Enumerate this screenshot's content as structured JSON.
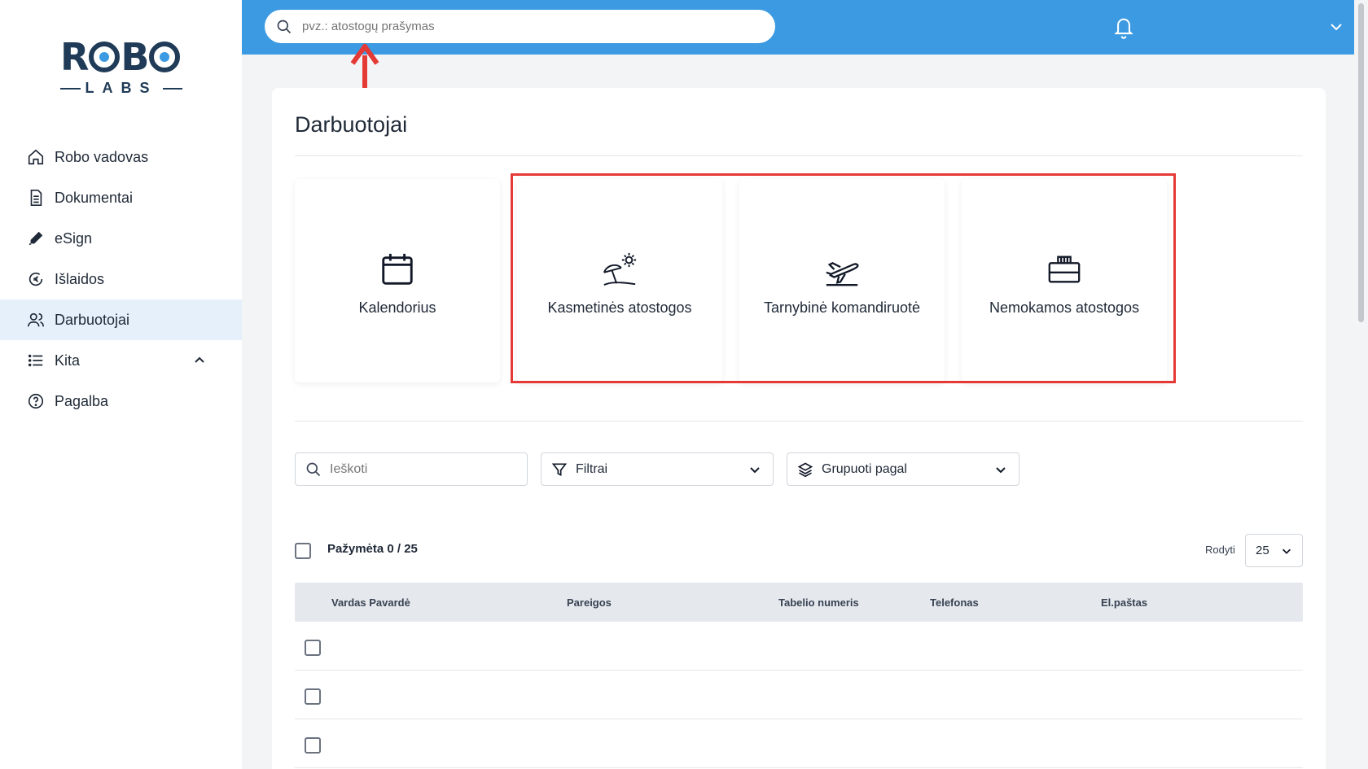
{
  "logo": {
    "word": "ROBO",
    "sub": "LABS"
  },
  "sidebar": {
    "items": [
      {
        "label": "Robo vadovas",
        "icon": "home-icon"
      },
      {
        "label": "Dokumentai",
        "icon": "document-icon"
      },
      {
        "label": "eSign",
        "icon": "pen-icon"
      },
      {
        "label": "Išlaidos",
        "icon": "euro-icon"
      },
      {
        "label": "Darbuotojai",
        "icon": "users-icon",
        "active": true
      },
      {
        "label": "Kita",
        "icon": "list-icon"
      },
      {
        "label": "Pagalba",
        "icon": "help-icon"
      }
    ]
  },
  "topbar": {
    "search_placeholder": "pvz.: atostogų prašymas"
  },
  "main": {
    "title": "Darbuotojai",
    "cards": [
      {
        "label": "Kalendorius",
        "icon": "calendar-icon"
      },
      {
        "label": "Kasmetinės atostogos",
        "icon": "beach-icon"
      },
      {
        "label": "Tarnybinė komandiruotė",
        "icon": "airplane-icon"
      },
      {
        "label": "Nemokamos atostogos",
        "icon": "briefcase-icon"
      }
    ],
    "search_placeholder": "Ieškoti",
    "filter_label": "Filtrai",
    "group_label": "Grupuoti pagal",
    "selected_label": "Pažymėta 0 / 25",
    "show_label": "Rodyti",
    "page_size": "25",
    "columns": [
      "Vardas Pavardė",
      "Pareigos",
      "Tabelio numeris",
      "Telefonas",
      "El.paštas"
    ]
  },
  "colors": {
    "topbar": "#3b9ae1",
    "active_nav": "#e5f0fb",
    "highlight": "#e53935"
  }
}
